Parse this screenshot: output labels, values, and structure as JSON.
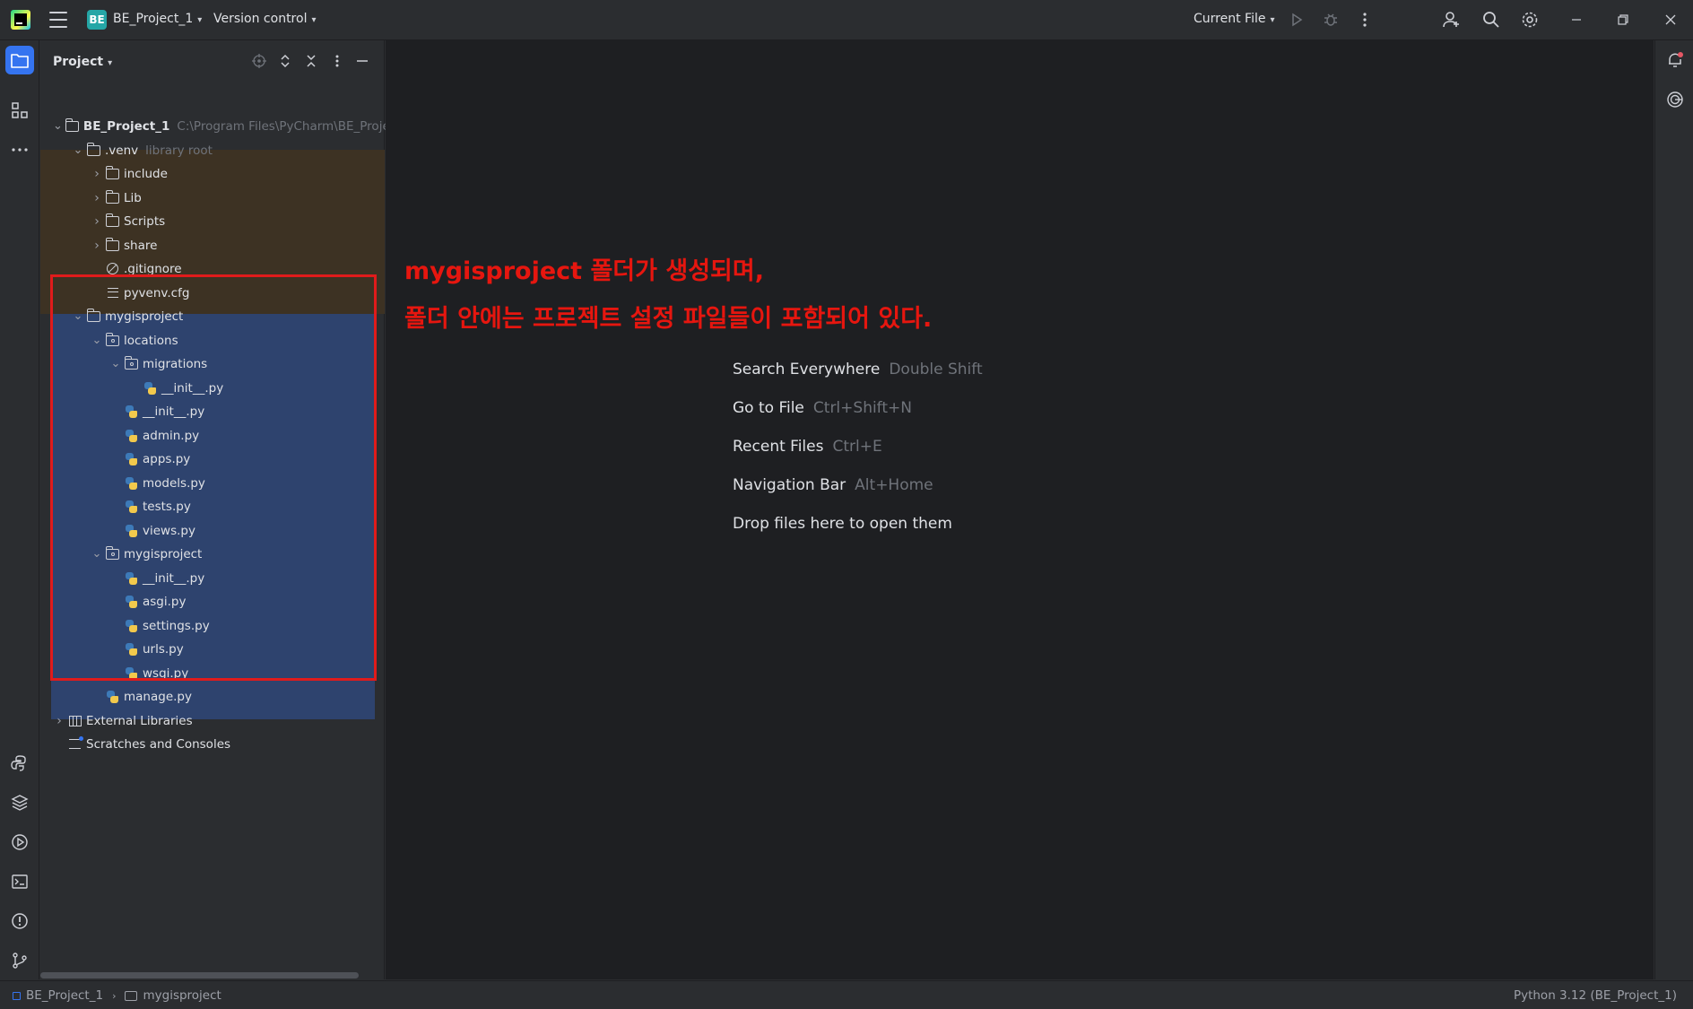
{
  "titlebar": {
    "project_badge": "BE",
    "project_name": "BE_Project_1",
    "version_control": "Version control",
    "run_config": "Current File"
  },
  "project_panel": {
    "title": "Project"
  },
  "tree": [
    {
      "label": "BE_Project_1",
      "hint": "C:\\Program Files\\PyCharm\\BE_Project",
      "depth": 0,
      "arrow": "down",
      "icon": "folder-icon",
      "bold": true
    },
    {
      "label": ".venv",
      "hint": "library root",
      "depth": 1,
      "arrow": "down",
      "icon": "folder-icon"
    },
    {
      "label": "include",
      "depth": 2,
      "arrow": "right",
      "icon": "folder-icon"
    },
    {
      "label": "Lib",
      "depth": 2,
      "arrow": "right",
      "icon": "folder-icon"
    },
    {
      "label": "Scripts",
      "depth": 2,
      "arrow": "right",
      "icon": "folder-icon"
    },
    {
      "label": "share",
      "depth": 2,
      "arrow": "right",
      "icon": "folder-icon"
    },
    {
      "label": ".gitignore",
      "depth": 2,
      "arrow": "",
      "icon": "ignore-file-icon"
    },
    {
      "label": "pyvenv.cfg",
      "depth": 2,
      "arrow": "",
      "icon": "config-file-icon"
    },
    {
      "label": "mygisproject",
      "depth": 1,
      "arrow": "down",
      "icon": "folder-icon"
    },
    {
      "label": "locations",
      "depth": 2,
      "arrow": "down",
      "icon": "package-folder-icon"
    },
    {
      "label": "migrations",
      "depth": 3,
      "arrow": "down",
      "icon": "package-folder-icon"
    },
    {
      "label": "__init__.py",
      "depth": 4,
      "arrow": "",
      "icon": "python-file-icon"
    },
    {
      "label": "__init__.py",
      "depth": 3,
      "arrow": "",
      "icon": "python-file-icon"
    },
    {
      "label": "admin.py",
      "depth": 3,
      "arrow": "",
      "icon": "python-file-icon"
    },
    {
      "label": "apps.py",
      "depth": 3,
      "arrow": "",
      "icon": "python-file-icon"
    },
    {
      "label": "models.py",
      "depth": 3,
      "arrow": "",
      "icon": "python-file-icon"
    },
    {
      "label": "tests.py",
      "depth": 3,
      "arrow": "",
      "icon": "python-file-icon"
    },
    {
      "label": "views.py",
      "depth": 3,
      "arrow": "",
      "icon": "python-file-icon"
    },
    {
      "label": "mygisproject",
      "depth": 2,
      "arrow": "down",
      "icon": "package-folder-icon"
    },
    {
      "label": "__init__.py",
      "depth": 3,
      "arrow": "",
      "icon": "python-file-icon"
    },
    {
      "label": "asgi.py",
      "depth": 3,
      "arrow": "",
      "icon": "python-file-icon"
    },
    {
      "label": "settings.py",
      "depth": 3,
      "arrow": "",
      "icon": "python-file-icon"
    },
    {
      "label": "urls.py",
      "depth": 3,
      "arrow": "",
      "icon": "python-file-icon"
    },
    {
      "label": "wsgi.py",
      "depth": 3,
      "arrow": "",
      "icon": "python-file-icon"
    },
    {
      "label": "manage.py",
      "depth": 2,
      "arrow": "",
      "icon": "python-file-icon"
    },
    {
      "label": "External Libraries",
      "depth": 0,
      "arrow": "right",
      "icon": "library-icon"
    },
    {
      "label": "Scratches and Consoles",
      "depth": 0,
      "arrow": "",
      "icon": "scratches-icon"
    }
  ],
  "annotation": {
    "line1": "mygisproject 폴더가 생성되며,",
    "line2": "폴더 안에는 프로젝트 설정 파일들이 포함되어 있다."
  },
  "editor_hints": [
    {
      "label": "Search Everywhere",
      "shortcut": "Double Shift"
    },
    {
      "label": "Go to File",
      "shortcut": "Ctrl+Shift+N"
    },
    {
      "label": "Recent Files",
      "shortcut": "Ctrl+E"
    },
    {
      "label": "Navigation Bar",
      "shortcut": "Alt+Home"
    },
    {
      "label": "Drop files here to open them",
      "shortcut": ""
    }
  ],
  "statusbar": {
    "crumb_project": "BE_Project_1",
    "crumb_folder": "mygisproject",
    "interpreter": "Python 3.12 (BE_Project_1)"
  },
  "colors": {
    "accent": "#3574f0",
    "annotation_red": "#e6160f",
    "selection": "#2e436e",
    "venv_bg": "#3d3223"
  }
}
